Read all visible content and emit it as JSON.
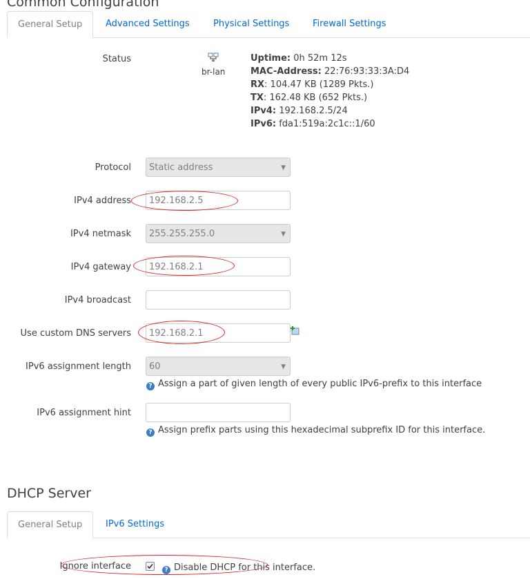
{
  "sections": {
    "common_title": "Common Configuration",
    "dhcp_title": "DHCP Server"
  },
  "common_tabs": [
    "General Setup",
    "Advanced Settings",
    "Physical Settings",
    "Firewall Settings"
  ],
  "dhcp_tabs": [
    "General Setup",
    "IPv6 Settings"
  ],
  "status": {
    "label": "Status",
    "device": "br-lan",
    "lines": [
      {
        "key": "Uptime:",
        "value": " 0h 52m 12s"
      },
      {
        "key": "MAC-Address:",
        "value": " 22:76:93:33:3A:D4"
      },
      {
        "key": "RX",
        "value": ": 104.47 KB (1289 Pkts.)"
      },
      {
        "key": "TX",
        "value": ": 162.48 KB (652 Pkts.)"
      },
      {
        "key": "IPv4:",
        "value": " 192.168.2.5/24"
      },
      {
        "key": "IPv6:",
        "value": " fda1:519a:2c1c::1/60"
      }
    ]
  },
  "fields": {
    "protocol": {
      "label": "Protocol",
      "value": "Static address"
    },
    "ipv4_address": {
      "label": "IPv4 address",
      "value": "192.168.2.5"
    },
    "ipv4_netmask": {
      "label": "IPv4 netmask",
      "value": "255.255.255.0"
    },
    "ipv4_gateway": {
      "label": "IPv4 gateway",
      "value": "192.168.2.1"
    },
    "ipv4_broadcast": {
      "label": "IPv4 broadcast",
      "value": ""
    },
    "dns": {
      "label": "Use custom DNS servers",
      "value": "192.168.2.1"
    },
    "ipv6_length": {
      "label": "IPv6 assignment length",
      "value": "60",
      "help": "Assign a part of given length of every public IPv6-prefix to this interface"
    },
    "ipv6_hint": {
      "label": "IPv6 assignment hint",
      "value": "",
      "help": "Assign prefix parts using this hexadecimal subprefix ID for this interface."
    }
  },
  "dhcp": {
    "ignore_label": "Ignore interface",
    "ignore_checked": true,
    "ignore_help": "Disable DHCP for this interface."
  },
  "colors": {
    "link": "#0069d6",
    "annotation": "#dd2222",
    "help_icon": "#3a7fc4"
  }
}
